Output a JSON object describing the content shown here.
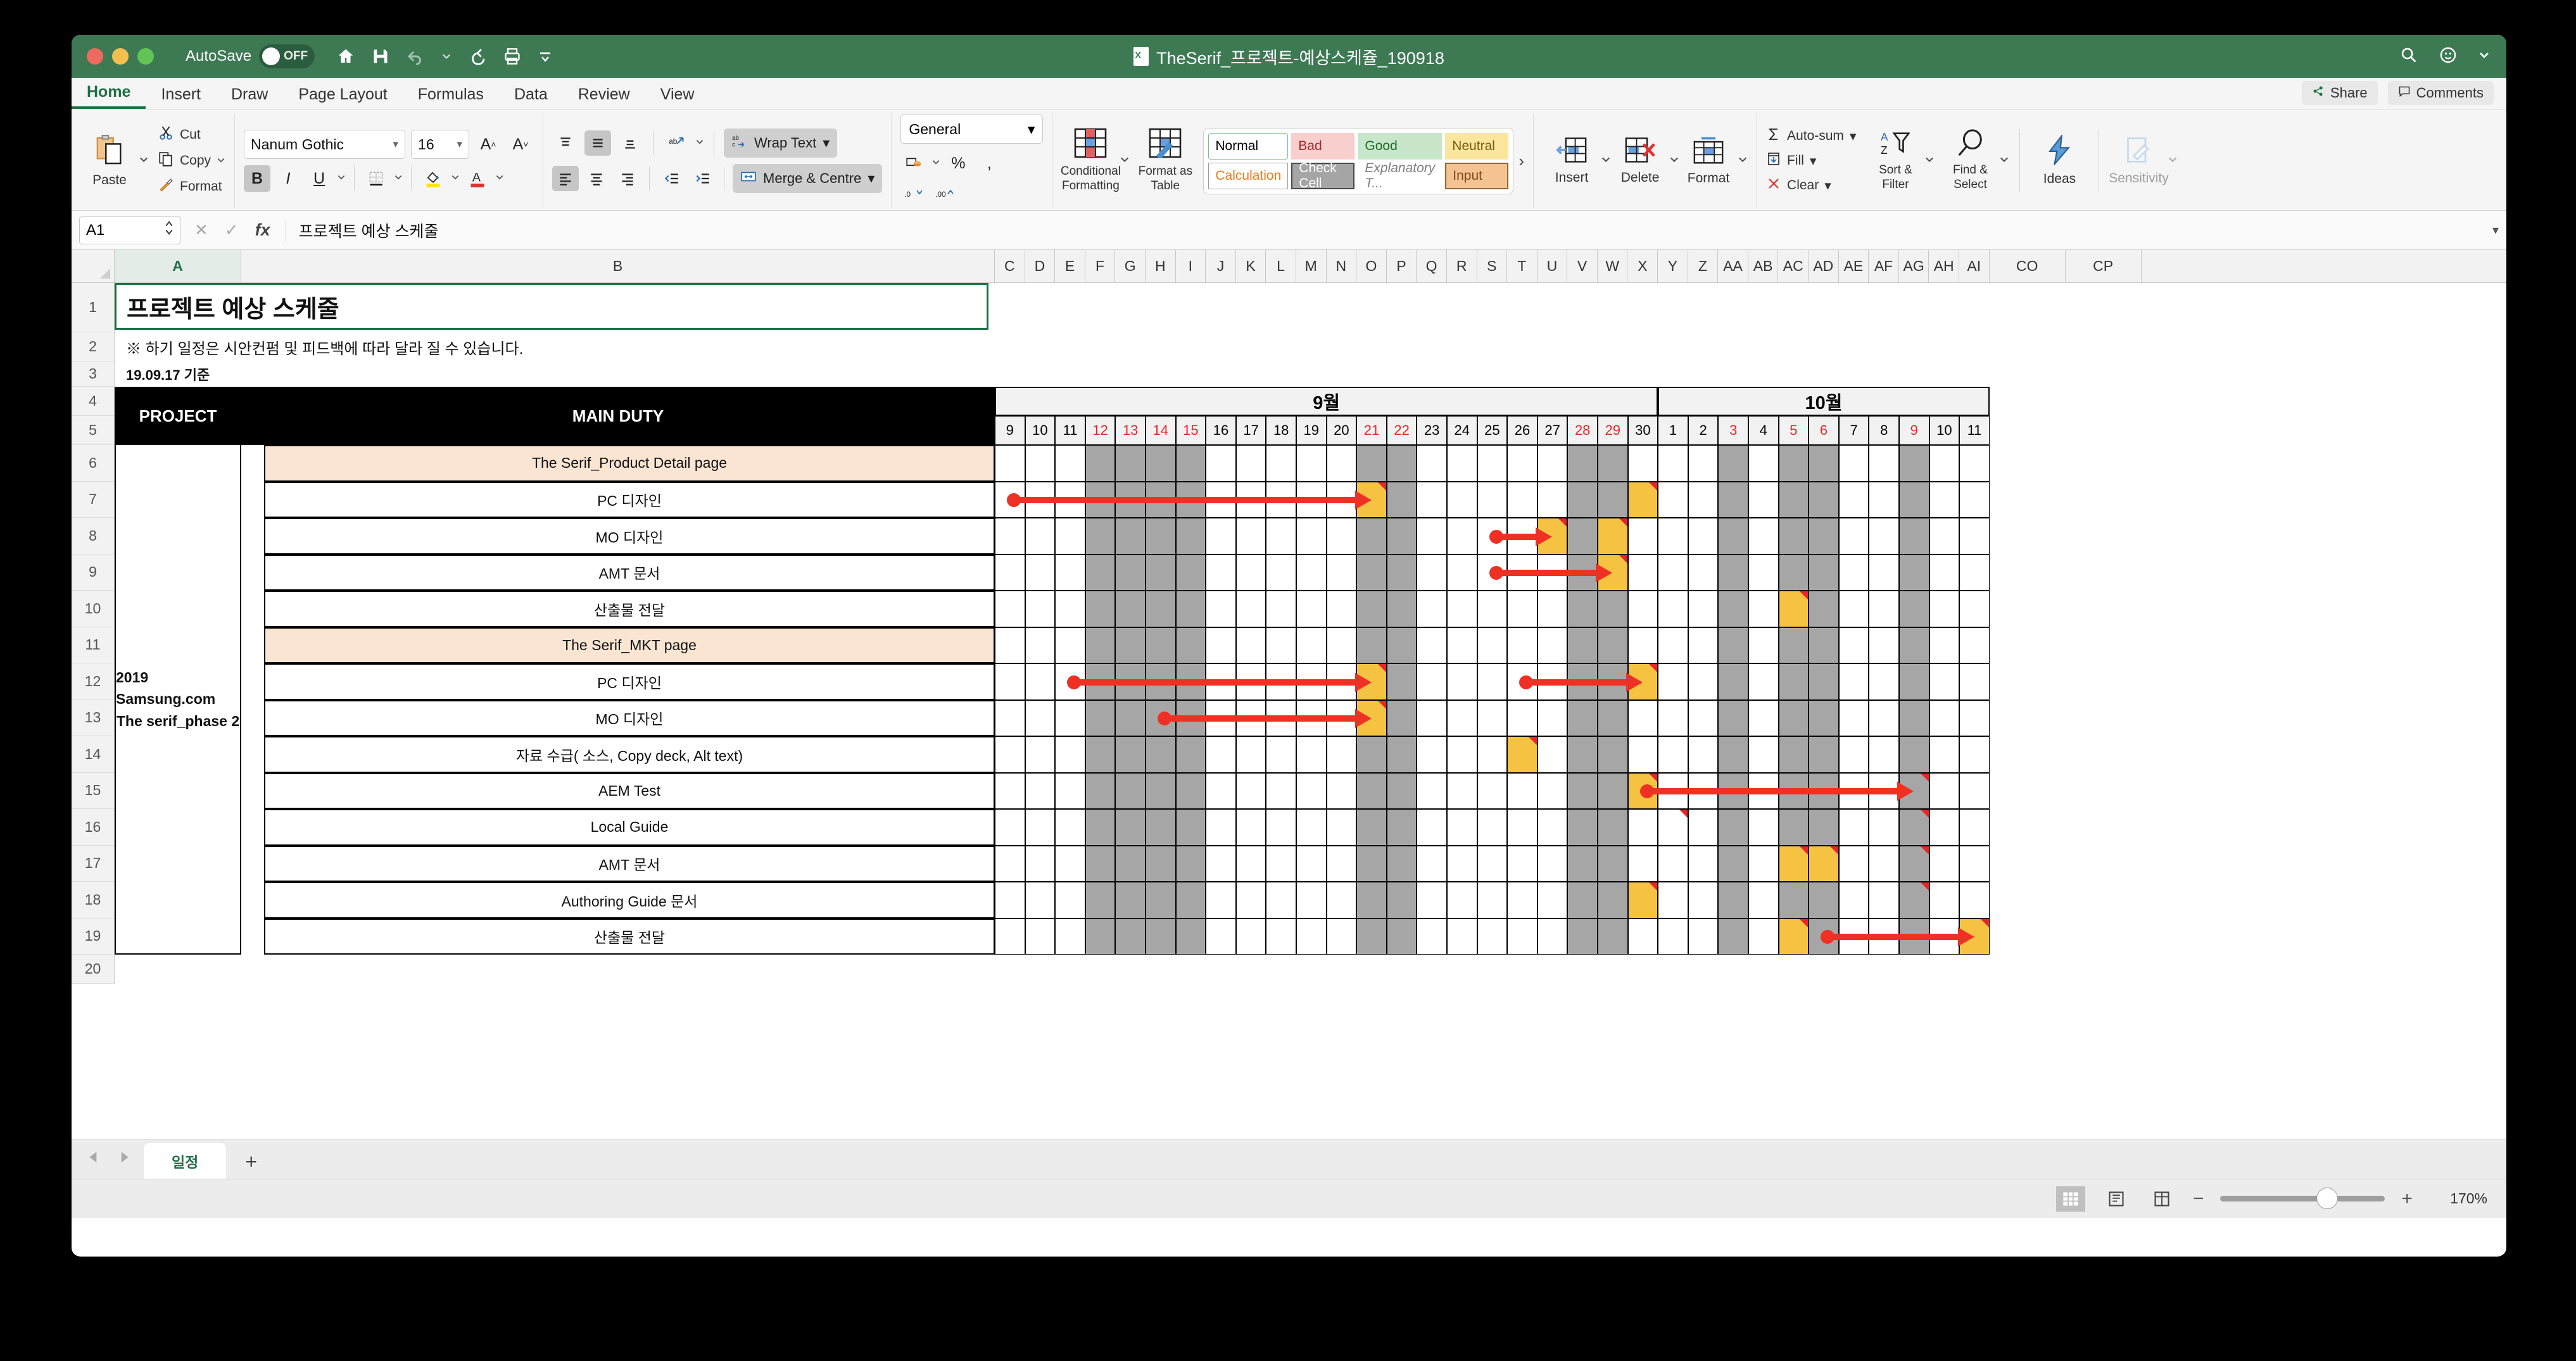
{
  "window": {
    "document_title": "TheSerif_프로젝트-예상스케쥴_190918",
    "autosave_label": "AutoSave",
    "autosave_state": "OFF",
    "quick_access": [
      "home-icon",
      "save-icon",
      "undo-icon",
      "undo-dropdown",
      "redo-icon",
      "print-icon",
      "customize-icon"
    ],
    "right_icons": [
      "search-icon",
      "account-icon",
      "menu-caret-icon"
    ]
  },
  "ribbon": {
    "tabs": [
      "Home",
      "Insert",
      "Draw",
      "Page Layout",
      "Formulas",
      "Data",
      "Review",
      "View"
    ],
    "active_tab": "Home",
    "share_label": "Share",
    "comments_label": "Comments",
    "clipboard": {
      "paste": "Paste",
      "cut": "Cut",
      "copy": "Copy",
      "format": "Format"
    },
    "font": {
      "family": "Nanum Gothic",
      "size": "16",
      "grow": "A",
      "shrink": "A",
      "bold": "B",
      "italic": "I",
      "underline": "U",
      "bold_active": true
    },
    "alignment": {
      "wrap_text": "Wrap Text",
      "merge_center": "Merge & Centre"
    },
    "number": {
      "format": "General",
      "percent": "%",
      "comma": ","
    },
    "styles": {
      "conditional_formatting": "Conditional Formatting",
      "format_as_table": "Format as Table",
      "gallery": [
        {
          "label": "Normal",
          "bg": "#ffffff",
          "fg": "#000000",
          "border": "#7fba8f"
        },
        {
          "label": "Bad",
          "bg": "#f9cfce",
          "fg": "#9c2c2c",
          "border": "transparent"
        },
        {
          "label": "Good",
          "bg": "#c8e6c9",
          "fg": "#1b6b2c",
          "border": "transparent"
        },
        {
          "label": "Neutral",
          "bg": "#fae69d",
          "fg": "#7a5c12",
          "border": "transparent"
        },
        {
          "label": "Calculation",
          "bg": "#ffffff",
          "fg": "#f07818",
          "border": "#9a9a9a"
        },
        {
          "label": "Check Cell",
          "bg": "#a5a5a5",
          "fg": "#ffffff",
          "border": "#4a4a4a"
        },
        {
          "label": "Explanatory T...",
          "bg": "#ffffff",
          "fg": "#7f7f7f",
          "border": "transparent"
        },
        {
          "label": "Input",
          "bg": "#f5c391",
          "fg": "#7a4a1c",
          "border": "#8a6a3a"
        }
      ],
      "expand": "›"
    },
    "cells": {
      "insert": "Insert",
      "delete": "Delete",
      "format": "Format"
    },
    "editing": {
      "autosum": "Auto-sum",
      "fill": "Fill",
      "clear": "Clear",
      "sort_filter": "Sort & Filter",
      "find_select": "Find & Select",
      "ideas": "Ideas",
      "sensitivity": "Sensitivity"
    }
  },
  "formula_bar": {
    "name_box": "A1",
    "cancel": "✕",
    "enter": "✓",
    "fx": "fx",
    "content": "프로젝트 예상 스케줄"
  },
  "grid": {
    "column_headers": [
      "A",
      "B",
      "C",
      "D",
      "E",
      "F",
      "G",
      "H",
      "I",
      "J",
      "K",
      "L",
      "M",
      "N",
      "O",
      "P",
      "Q",
      "R",
      "S",
      "T",
      "U",
      "V",
      "W",
      "X",
      "Y",
      "Z",
      "AA",
      "AB",
      "AC",
      "AD",
      "AE",
      "AF",
      "AG",
      "AH",
      "AI",
      "CO",
      "CP"
    ],
    "selected_column": "A",
    "row_headers": [
      "1",
      "2",
      "3",
      "4",
      "5",
      "6",
      "7",
      "8",
      "9",
      "10",
      "11",
      "12",
      "13",
      "14",
      "15",
      "16",
      "17",
      "18",
      "19",
      "20"
    ],
    "a1_title": "프로젝트 예상 스케줄",
    "a2_note": "※ 하기 일정은 시안컨펌 및 피드백에 따라 달라 질 수 있습니다.",
    "a3_date": "19.09.17 기준",
    "header_project": "PROJECT",
    "header_main_duty": "MAIN DUTY",
    "project_name_line1": "2019 Samsung.com",
    "project_name_line2": "The serif_phase 2",
    "duties": [
      {
        "row": "6",
        "label": "The Serif_Product Detail page",
        "section": true
      },
      {
        "row": "7",
        "label": "PC 디자인",
        "section": false
      },
      {
        "row": "8",
        "label": "MO 디자인",
        "section": false
      },
      {
        "row": "9",
        "label": "AMT 문서",
        "section": false
      },
      {
        "row": "10",
        "label": "산출물 전달",
        "section": false
      },
      {
        "row": "11",
        "label": "The Serif_MKT page",
        "section": true
      },
      {
        "row": "12",
        "label": "PC 디자인",
        "section": false
      },
      {
        "row": "13",
        "label": "MO 디자인",
        "section": false
      },
      {
        "row": "14",
        "label": "자료 수급( 소스, Copy deck, Alt text)",
        "section": false
      },
      {
        "row": "15",
        "label": "AEM Test",
        "section": false
      },
      {
        "row": "16",
        "label": "Local Guide",
        "section": false
      },
      {
        "row": "17",
        "label": "AMT 문서",
        "section": false
      },
      {
        "row": "18",
        "label": "Authoring Guide 문서",
        "section": false
      },
      {
        "row": "19",
        "label": "산출물 전달",
        "section": false
      }
    ]
  },
  "chart_data": {
    "type": "table",
    "title": "프로젝트 예상 스케줄",
    "months": [
      {
        "label": "9월",
        "span": 22
      },
      {
        "label": "10월",
        "span": 11
      }
    ],
    "days": [
      {
        "d": "9",
        "holiday": false,
        "weekend": false
      },
      {
        "d": "10",
        "holiday": false,
        "weekend": false
      },
      {
        "d": "11",
        "holiday": false,
        "weekend": false
      },
      {
        "d": "12",
        "holiday": true,
        "weekend": true
      },
      {
        "d": "13",
        "holiday": true,
        "weekend": true
      },
      {
        "d": "14",
        "holiday": true,
        "weekend": true
      },
      {
        "d": "15",
        "holiday": true,
        "weekend": true
      },
      {
        "d": "16",
        "holiday": false,
        "weekend": false
      },
      {
        "d": "17",
        "holiday": false,
        "weekend": false
      },
      {
        "d": "18",
        "holiday": false,
        "weekend": false
      },
      {
        "d": "19",
        "holiday": false,
        "weekend": false
      },
      {
        "d": "20",
        "holiday": false,
        "weekend": false
      },
      {
        "d": "21",
        "holiday": true,
        "weekend": true
      },
      {
        "d": "22",
        "holiday": true,
        "weekend": true
      },
      {
        "d": "23",
        "holiday": false,
        "weekend": false
      },
      {
        "d": "24",
        "holiday": false,
        "weekend": false
      },
      {
        "d": "25",
        "holiday": false,
        "weekend": false
      },
      {
        "d": "26",
        "holiday": false,
        "weekend": false
      },
      {
        "d": "27",
        "holiday": false,
        "weekend": false
      },
      {
        "d": "28",
        "holiday": true,
        "weekend": true
      },
      {
        "d": "29",
        "holiday": true,
        "weekend": true
      },
      {
        "d": "30",
        "holiday": false,
        "weekend": false
      },
      {
        "d": "1",
        "holiday": false,
        "weekend": false
      },
      {
        "d": "2",
        "holiday": false,
        "weekend": false
      },
      {
        "d": "3",
        "holiday": true,
        "weekend": true
      },
      {
        "d": "4",
        "holiday": false,
        "weekend": false
      },
      {
        "d": "5",
        "holiday": true,
        "weekend": true
      },
      {
        "d": "6",
        "holiday": true,
        "weekend": true
      },
      {
        "d": "7",
        "holiday": false,
        "weekend": false
      },
      {
        "d": "8",
        "holiday": false,
        "weekend": false
      },
      {
        "d": "9",
        "holiday": true,
        "weekend": true
      },
      {
        "d": "10",
        "holiday": false,
        "weekend": false
      },
      {
        "d": "11",
        "holiday": false,
        "weekend": false
      }
    ],
    "tasks": [
      {
        "row": "6",
        "name": "The Serif_Product Detail page",
        "milestones": [],
        "comments": [],
        "arrows": []
      },
      {
        "row": "7",
        "name": "PC 디자인",
        "milestones": [
          12
        ],
        "comments": [
          12,
          21
        ],
        "extra_fill": [
          21
        ],
        "arrows": [
          {
            "from": 0,
            "to": 12,
            "dot": true
          }
        ]
      },
      {
        "row": "8",
        "name": "MO 디자인",
        "milestones": [
          18,
          20
        ],
        "comments": [
          18,
          20
        ],
        "arrows": [
          {
            "from": 16,
            "to": 18,
            "dot": true
          }
        ]
      },
      {
        "row": "9",
        "name": "AMT 문서",
        "milestones": [
          20
        ],
        "comments": [
          20
        ],
        "arrows": [
          {
            "from": 16,
            "to": 20,
            "dot": true
          }
        ]
      },
      {
        "row": "10",
        "name": "산출물 전달",
        "milestones": [
          26
        ],
        "comments": [
          26
        ],
        "arrows": []
      },
      {
        "row": "11",
        "name": "The Serif_MKT page",
        "milestones": [],
        "comments": [],
        "arrows": []
      },
      {
        "row": "12",
        "name": "PC 디자인",
        "milestones": [
          12,
          21
        ],
        "comments": [
          12,
          21
        ],
        "arrows": [
          {
            "from": 2,
            "to": 12,
            "dot": true
          },
          {
            "from": 17,
            "to": 21,
            "dot": true
          }
        ]
      },
      {
        "row": "13",
        "name": "MO 디자인",
        "milestones": [
          12
        ],
        "comments": [
          12
        ],
        "arrows": [
          {
            "from": 5,
            "to": 12,
            "dot": true
          }
        ]
      },
      {
        "row": "14",
        "name": "자료 수급( 소스, Copy deck, Alt text)",
        "milestones": [
          17
        ],
        "comments": [
          17
        ],
        "arrows": []
      },
      {
        "row": "15",
        "name": "AEM Test",
        "milestones": [
          21
        ],
        "comments": [
          21,
          30
        ],
        "arrows": [
          {
            "from": 21,
            "to": 30,
            "dot": true
          }
        ]
      },
      {
        "row": "16",
        "name": "Local Guide",
        "milestones": [],
        "comments": [
          22,
          30
        ],
        "arrows": []
      },
      {
        "row": "17",
        "name": "AMT 문서",
        "milestones": [
          26,
          27
        ],
        "comments": [
          26,
          27,
          30
        ],
        "arrows": []
      },
      {
        "row": "18",
        "name": "Authoring Guide 문서",
        "milestones": [
          21
        ],
        "comments": [
          21,
          30
        ],
        "arrows": []
      },
      {
        "row": "19",
        "name": "산출물 전달",
        "milestones": [
          26,
          32
        ],
        "comments": [
          26,
          32,
          33
        ],
        "arrows": [
          {
            "from": 27,
            "to": 32,
            "dot": true
          }
        ]
      }
    ],
    "legend": {
      "milestone_color": "#f5c242",
      "weekend_color": "#a6a6a6",
      "arrow_color": "#ee3124",
      "section_color": "#fae5d3",
      "header_color": "#000000"
    }
  },
  "sheet_tabs": {
    "prev": "◀",
    "next": "▶",
    "tabs": [
      "일정"
    ],
    "active": "일정",
    "add": "+"
  },
  "status_bar": {
    "views": [
      "normal-view",
      "page-layout-view",
      "page-break-view"
    ],
    "active_view": "normal-view",
    "zoom_out": "−",
    "zoom_in": "+",
    "zoom_level": "170%"
  }
}
